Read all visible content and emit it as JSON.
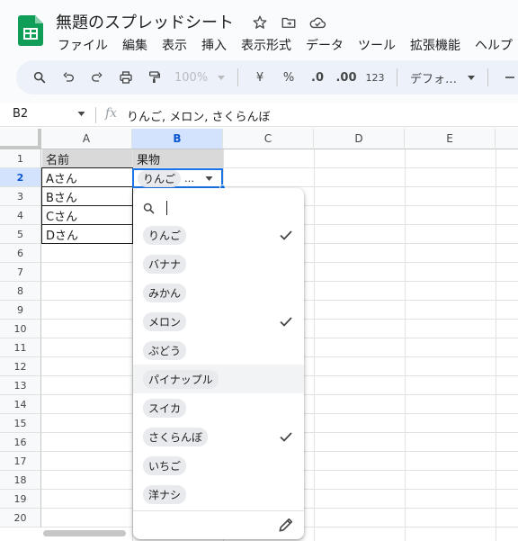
{
  "header": {
    "title": "無題のスプレッドシート",
    "icons": [
      "star-icon",
      "move-to-folder-icon",
      "cloud-status-icon"
    ]
  },
  "menu": [
    "ファイル",
    "編集",
    "表示",
    "挿入",
    "表示形式",
    "データ",
    "ツール",
    "拡張機能",
    "ヘルプ"
  ],
  "toolbar": {
    "zoom": "100%",
    "currency": "¥",
    "percent": "%",
    "decrease_decimal": ".0",
    "increase_decimal": ".00",
    "number_format": "123",
    "font": "デフォ…"
  },
  "formula_bar": {
    "cell_ref": "B2",
    "fx": "fx",
    "content": "りんご, メロン, さくらんぼ"
  },
  "grid": {
    "columns": [
      "A",
      "B",
      "C",
      "D",
      "E"
    ],
    "rows": [
      "1",
      "2",
      "3",
      "4",
      "5",
      "6",
      "7",
      "8",
      "9",
      "10",
      "11",
      "12",
      "13",
      "14",
      "15",
      "16",
      "17",
      "18",
      "19",
      "20"
    ],
    "cells": {
      "a1": "名前",
      "b1": "果物",
      "a2": "Aさん",
      "a3": "Bさん",
      "a4": "Cさん",
      "a5": "Dさん"
    },
    "active_cell": {
      "chip": "りんご",
      "more": "…"
    }
  },
  "dropdown": {
    "options": [
      {
        "label": "りんご",
        "checked": true
      },
      {
        "label": "バナナ",
        "checked": false
      },
      {
        "label": "みかん",
        "checked": false
      },
      {
        "label": "メロン",
        "checked": true
      },
      {
        "label": "ぶどう",
        "checked": false
      },
      {
        "label": "パイナップル",
        "checked": false
      },
      {
        "label": "スイカ",
        "checked": false
      },
      {
        "label": "さくらんぼ",
        "checked": true
      },
      {
        "label": "いちご",
        "checked": false
      },
      {
        "label": "洋ナシ",
        "checked": false
      }
    ]
  }
}
